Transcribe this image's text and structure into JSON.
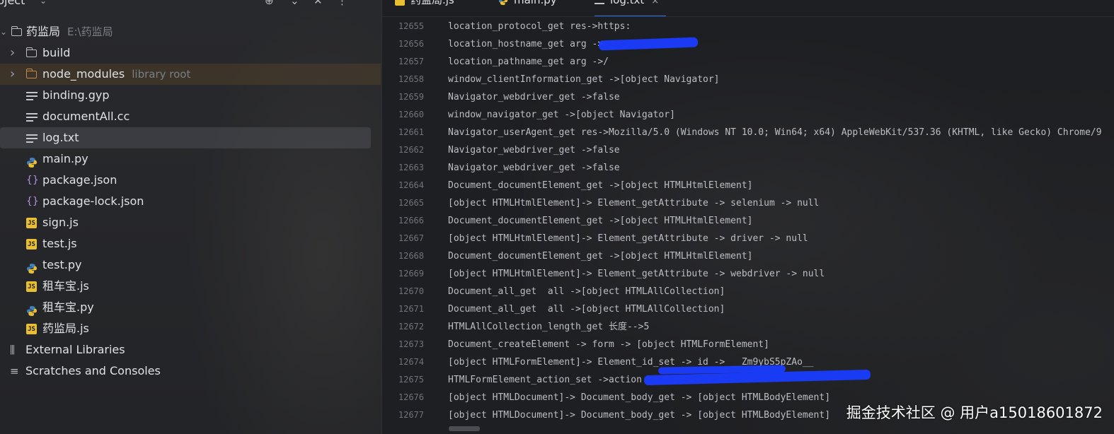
{
  "project_panel": {
    "title": "roject",
    "header_buttons": [
      "target-icon",
      "chevron-up-down-icon",
      "close-icon",
      "more-icon"
    ],
    "tree": [
      {
        "name": "药监局",
        "sub": "E:\\药监局",
        "type": "folder",
        "arrow": "open"
      },
      {
        "name": "build",
        "type": "folder",
        "arrow": "closed"
      },
      {
        "name": "node_modules",
        "sub": "library root",
        "type": "folder-orange",
        "arrow": "closed"
      },
      {
        "name": "binding.gyp",
        "type": "text"
      },
      {
        "name": "documentAll.cc",
        "type": "text"
      },
      {
        "name": "log.txt",
        "type": "text",
        "selected": true
      },
      {
        "name": "main.py",
        "type": "python"
      },
      {
        "name": "package.json",
        "type": "json"
      },
      {
        "name": "package-lock.json",
        "type": "json"
      },
      {
        "name": "sign.js",
        "type": "js"
      },
      {
        "name": "test.js",
        "type": "js"
      },
      {
        "name": "test.py",
        "type": "python"
      },
      {
        "name": "租车宝.js",
        "type": "js"
      },
      {
        "name": "租车宝.py",
        "type": "python"
      },
      {
        "name": "药监局.js",
        "type": "js"
      },
      {
        "name": "External Libraries",
        "type": "library"
      },
      {
        "name": "Scratches and Consoles",
        "type": "scratches"
      }
    ]
  },
  "editor": {
    "tabs": [
      {
        "label": "药监局.js",
        "icon": "js-icon"
      },
      {
        "label": "main.py",
        "icon": "python-icon"
      },
      {
        "label": "log.txt",
        "icon": "text-file-icon",
        "active": true,
        "close": "×"
      }
    ],
    "lines": [
      {
        "n": "12655",
        "text": "location_protocol_get res->https:"
      },
      {
        "n": "12656",
        "text": "location_hostname_get arg ->"
      },
      {
        "n": "12657",
        "text": "location_pathname_get arg ->/"
      },
      {
        "n": "12658",
        "text": "window_clientInformation_get ->[object Navigator]"
      },
      {
        "n": "12659",
        "text": "Navigator_webdriver_get ->false"
      },
      {
        "n": "12660",
        "text": "window_navigator_get ->[object Navigator]"
      },
      {
        "n": "12661",
        "text": "Navigator_userAgent_get res->Mozilla/5.0 (Windows NT 10.0; Win64; x64) AppleWebKit/537.36 (KHTML, like Gecko) Chrome/9"
      },
      {
        "n": "12662",
        "text": "Navigator_webdriver_get ->false"
      },
      {
        "n": "12663",
        "text": "Navigator_webdriver_get ->false"
      },
      {
        "n": "12664",
        "text": "Document_documentElement_get ->[object HTMLHtmlElement]"
      },
      {
        "n": "12665",
        "text": "[object HTMLHtmlElement]-> Element_getAttribute -> selenium -> null"
      },
      {
        "n": "12666",
        "text": "Document_documentElement_get ->[object HTMLHtmlElement]"
      },
      {
        "n": "12667",
        "text": "[object HTMLHtmlElement]-> Element_getAttribute -> driver -> null"
      },
      {
        "n": "12668",
        "text": "Document_documentElement_get ->[object HTMLHtmlElement]"
      },
      {
        "n": "12669",
        "text": "[object HTMLHtmlElement]-> Element_getAttribute -> webdriver -> null"
      },
      {
        "n": "12670",
        "text": "Document_all_get  all ->[object HTMLAllCollection]"
      },
      {
        "n": "12671",
        "text": "Document_all_get  all ->[object HTMLAllCollection]"
      },
      {
        "n": "12672",
        "text": "HTMLAllCollection_length_get 长度-->5"
      },
      {
        "n": "12673",
        "text": "Document_createElement -> form -> [object HTMLFormElement]"
      },
      {
        "n": "12674",
        "text": "[object HTMLFormElement]-> Element_id_set -> id -> __Zm9ybS5pZAo__"
      },
      {
        "n": "12675",
        "text": "HTMLFormElement_action_set ->action"
      },
      {
        "n": "12676",
        "text": "[object HTMLDocument]-> Document_body_get -> [object HTMLBodyElement]"
      },
      {
        "n": "12677",
        "text": "[object HTMLDocument]-> Document_body_get -> [object HTMLBodyElement]"
      }
    ]
  },
  "watermark": "掘金技术社区 @ 用户a15018601872"
}
